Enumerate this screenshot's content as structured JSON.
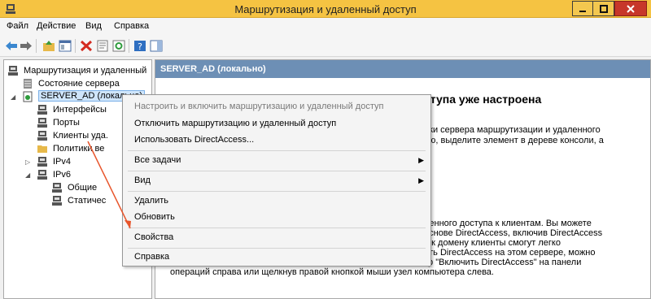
{
  "window": {
    "title": "Маршрутизация и удаленный доступ"
  },
  "menu": {
    "file": "Файл",
    "action": "Действие",
    "view": "Вид",
    "help": "Справка"
  },
  "tree": {
    "root": "Маршрутизация и удаленный",
    "status": "Состояние сервера",
    "server": "SERVER_AD (локально)",
    "interfaces": "Интерфейсы",
    "ports": "Порты",
    "clients": "Клиенты уда.",
    "policies": "Политики ве",
    "ipv4": "IPv4",
    "ipv6": "IPv6",
    "general": "Общие",
    "static": "Статичес"
  },
  "details": {
    "header": "SERVER_AD (локально)",
    "heading": "ступа уже настроена",
    "line1": "йки сервера маршрутизации и удаленного",
    "line2": "ию, выделите элемент в дереве консоли, а",
    "line3": "ленного доступа к клиентам. Вы можете",
    "line4": "основе DirectAccess, включив DirectAccess",
    "line5": "е к домену клиенты смогут легко",
    "line6": "ить DirectAccess на этом сервере, можно",
    "line7": "тр \"Включить DirectAccess\" на панели",
    "line8": "операций справа или щелкнув правой кнопкой мыши узел компьютера слева."
  },
  "context_menu": {
    "configure": "Настроить и включить маршрутизацию и удаленный доступ",
    "disable": "Отключить маршрутизацию и удаленный доступ",
    "directaccess": "Использовать DirectAccess...",
    "all_tasks": "Все задачи",
    "view": "Вид",
    "delete": "Удалить",
    "refresh": "Обновить",
    "properties": "Свойства",
    "help": "Справка"
  },
  "colors": {
    "titlebar": "#f5c342",
    "close": "#c7372a",
    "header": "#6d8fb5",
    "arrow": "#e8552b"
  }
}
